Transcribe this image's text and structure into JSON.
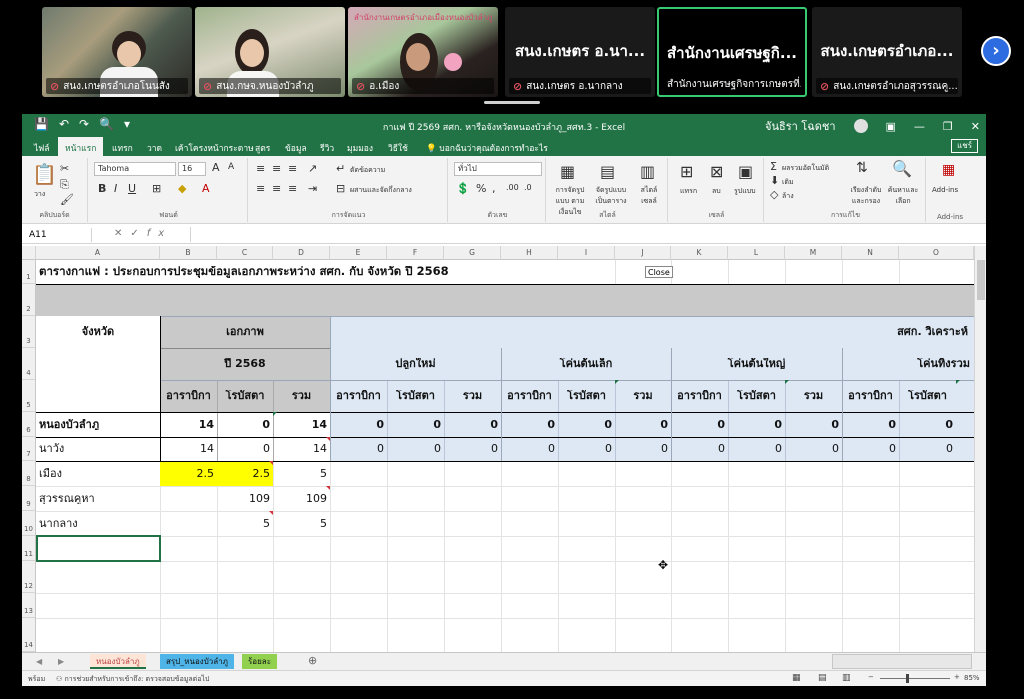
{
  "meeting": {
    "tiles": [
      {
        "name": "สนง.เกษตรอำเภอโนนสัง"
      },
      {
        "name": "สนง.กษจ.หนองบัวลำภู"
      },
      {
        "name": "อ.เมือง"
      }
    ],
    "text_tiles": [
      {
        "big": "สนง.เกษตร อ.นา...",
        "name": "สนง.เกษตร อ.นากลาง",
        "active": false
      },
      {
        "big": "สำนักงานเศรษฐกิ...",
        "name": "สำนักงานเศรษฐกิจการเกษตรที่...",
        "active": true
      },
      {
        "big": "สนง.เกษตรอำเภอ...",
        "name": "สนง.เกษตรอำเภอสุวรรณคู...",
        "active": false
      }
    ],
    "next_icon": "›",
    "tile3_sign": "สำนักงานเกษตรอำเภอเมืองหนองบัวลำภู"
  },
  "excel": {
    "title": "กาแฟ ปี 2569 สศก. หารือจังหวัดหนองบัวลำภู_สศท.3  -  Excel",
    "user": "จันธิรา โฉดชา",
    "qat_icons": [
      "💾",
      "↶",
      "↷",
      "🔍",
      "▾"
    ],
    "tabs": [
      "ไฟล์",
      "หน้าแรก",
      "แทรก",
      "วาด",
      "เค้าโครงหน้ากระดาษ",
      "สูตร",
      "ข้อมูล",
      "รีวิว",
      "มุมมอง",
      "วิธีใช้",
      "บอกฉันว่าคุณต้องการทำอะไร"
    ],
    "share": "แชร์",
    "ribbon": {
      "font_name": "Tahoma",
      "font_size": "16",
      "number_format": "ทั่วไป",
      "groups": [
        "คลิปบอร์ด",
        "ฟอนต์",
        "การจัดแนว",
        "ตัวเลข",
        "สไตล์",
        "เซลล์",
        "การแก้ไข",
        "Add-ins"
      ],
      "paste": "วาง",
      "wrap": "ตัดข้อความ",
      "merge": "ผสานและจัดกึ่งกลาง",
      "cond_format": "การจัดรูปแบบ ตามเงื่อนไข",
      "format_table": "จัดรูปแบบ เป็นตาราง",
      "cell_styles": "สไตล์ เซลล์",
      "insert": "แทรก",
      "delete": "ลบ",
      "format": "รูปแบบ",
      "autosum": "ผลรวมอัตโนมัติ",
      "fill": "เติม",
      "clear": "ล้าง",
      "sort": "เรียงลำดับ และกรอง",
      "find": "ค้นหาและ เลือก",
      "addins": "Add-ins"
    },
    "namebox": "A11",
    "fx": "fx",
    "columns": [
      "A",
      "B",
      "C",
      "D",
      "E",
      "F",
      "G",
      "H",
      "I",
      "J",
      "K",
      "L",
      "M",
      "N",
      "O"
    ],
    "rows": [
      "1",
      "2",
      "3",
      "4",
      "5",
      "6",
      "7",
      "8",
      "9",
      "10",
      "11",
      "12",
      "13",
      "14"
    ],
    "sheet": {
      "title": "ตารางกาแฟ : ประกอบการประชุมข้อมูลเอกภาพระหว่าง สศก. กับ จังหวัด ปี 2568",
      "province_hdr": "จังหวัด",
      "ekkaphap": "เอกภาพ",
      "year": "ปี 2568",
      "sok_analysis": "สศก. วิเคราะห์",
      "groups": [
        "ปลูกใหม่",
        "โค่นต้นเล็ก",
        "โค่นต้นใหญ่",
        "โค่นทิ้งรวม"
      ],
      "sub": {
        "arabica": "อาราบิกา",
        "robusta": "โรบัสตา",
        "total": "รวม"
      },
      "r6": {
        "name": "หนองบัวลำภู",
        "b": "14",
        "c": "0",
        "d": "14",
        "e": "0",
        "f": "0",
        "g": "0",
        "h": "0",
        "i": "0",
        "j": "0",
        "k": "0",
        "l": "0",
        "m": "0",
        "n": "0",
        "o": "0"
      },
      "r7": {
        "name": "นาวัง",
        "b": "14",
        "c": "0",
        "d": "14",
        "e": "0",
        "f": "0",
        "g": "0",
        "h": "0",
        "i": "0",
        "j": "0",
        "k": "0",
        "l": "0",
        "m": "0",
        "n": "0",
        "o": "0"
      },
      "r8": {
        "name": "เมือง",
        "b": "2.5",
        "c": "2.5",
        "d": "5"
      },
      "r9": {
        "name": "สุวรรณคูหา",
        "c": "109",
        "d": "109"
      },
      "r10": {
        "name": "นากลาง",
        "c": "5",
        "d": "5"
      }
    },
    "close_tip": "Close",
    "sheet_tabs": [
      "หนองบัวลำภู",
      "สรุป_หนองบัวลำภู",
      "ร้อยละ"
    ],
    "add_sheet": "⊕",
    "status_ready": "พร้อม",
    "status_accessibility": "การช่วยสำหรับการเข้าถึง: ตรวจสอบข้อมูลต่อไป",
    "zoom": "85%",
    "colors": {
      "excel_green": "#217346",
      "header_grey": "#c9c9c9",
      "header_blue": "#dde8f4",
      "highlight": "#ffff00",
      "meet_active": "#37c870"
    }
  }
}
